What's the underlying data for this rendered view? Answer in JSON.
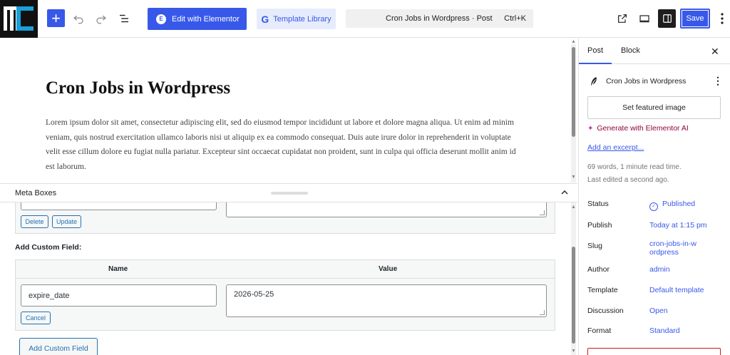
{
  "toolbar": {
    "logo_alt": "MC",
    "elementor_label": "Edit with Elementor",
    "template_label": "Template Library",
    "command_title": "Cron Jobs in Wordpress · Post",
    "command_shortcut": "Ctrl+K",
    "save_label": "Save",
    "icons": [
      "add-icon",
      "undo-icon",
      "redo-icon",
      "list-view-icon",
      "elementor-icon",
      "template-library-icon",
      "external-link-icon",
      "desktop-preview-icon",
      "settings-panel-icon",
      "more-options-icon"
    ]
  },
  "editor": {
    "title": "Cron Jobs in Wordpress",
    "body": "Lorem ipsum dolor sit amet, consectetur adipiscing elit, sed do eiusmod tempor incididunt ut labore et dolore magna aliqua. Ut enim ad minim veniam, quis nostrud exercitation ullamco laboris nisi ut aliquip ex ea commodo consequat. Duis aute irure dolor in reprehenderit in voluptate velit esse cillum dolore eu fugiat nulla pariatur. Excepteur sint occaecat cupidatat non proident, sunt in culpa qui officia deserunt mollit anim id est laborum."
  },
  "meta_boxes": {
    "header_label": "Meta Boxes",
    "existing_row": {
      "delete_label": "Delete",
      "update_label": "Update"
    },
    "add_custom_field_title": "Add Custom Field:",
    "columns": [
      "Name",
      "Value"
    ],
    "new_field": {
      "name_value": "expire_date",
      "value_value": "2026-05-25",
      "cancel_label": "Cancel"
    },
    "add_button_label": "Add Custom Field"
  },
  "sidebar": {
    "tabs": [
      "Post",
      "Block"
    ],
    "active_tab": "Post",
    "doc_title": "Cron Jobs in Wordpress",
    "featured_image_label": "Set featured image",
    "ai_label": "Generate with Elementor AI",
    "excerpt_label": "Add an excerpt...",
    "word_info": "69 words, 1 minute read time.",
    "edited_info": "Last edited a second ago.",
    "fields": [
      {
        "label": "Status",
        "value": "Published"
      },
      {
        "label": "Publish",
        "value": "Today at 1:15 pm"
      },
      {
        "label": "Slug",
        "value": "cron-jobs-in-wordpress"
      },
      {
        "label": "Author",
        "value": "admin"
      },
      {
        "label": "Template",
        "value": "Default template"
      },
      {
        "label": "Discussion",
        "value": "Open"
      },
      {
        "label": "Format",
        "value": "Standard"
      }
    ]
  },
  "colors": {
    "wp_blue": "#3858e9",
    "admin_blue": "#2271b1",
    "ai_color": "#93003f"
  }
}
